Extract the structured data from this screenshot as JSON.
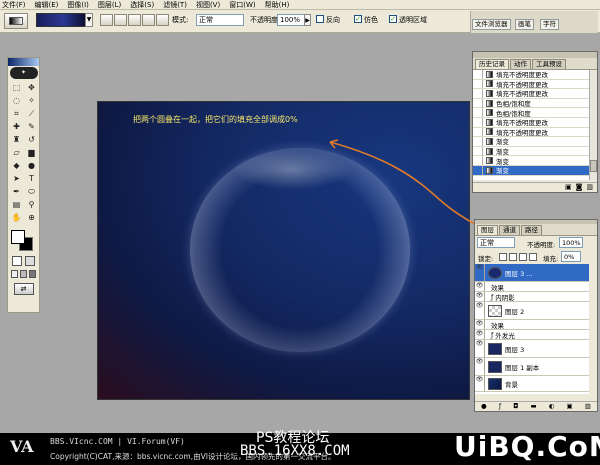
{
  "menu": [
    "文件(F)",
    "编辑(E)",
    "图像(I)",
    "图层(L)",
    "选择(S)",
    "滤镜(T)",
    "视图(V)",
    "窗口(W)",
    "帮助(H)"
  ],
  "options": {
    "mode_label": "模式:",
    "mode_value": "正常",
    "opacity_label": "不透明度:",
    "opacity_value": "100%",
    "reverse_label": "反向",
    "dither_label": "仿色",
    "transparency_label": "透明区域"
  },
  "dock_tabs": [
    "文件浏览器",
    "画笔",
    "字符"
  ],
  "canvas": {
    "caption": "把两个圆叠在一起，把它们的填充全部调成0%"
  },
  "history": {
    "tabs": [
      "历史记录",
      "动作",
      "工具预设"
    ],
    "items": [
      "填充不透明度更改",
      "填充不透明度更改",
      "填充不透明度更改",
      "色相/饱和度",
      "色相/饱和度",
      "填充不透明度更改",
      "填充不透明度更改",
      "渐变",
      "渐变",
      "渐变",
      "渐变"
    ]
  },
  "layers": {
    "tabs": [
      "图层",
      "通道",
      "路径"
    ],
    "blend_mode": "正常",
    "opacity_label": "不透明度:",
    "opacity_value": "100%",
    "lock_label": "锁定:",
    "fill_label": "填充:",
    "fill_value": "0%",
    "rows": [
      {
        "name": "图层 3 ...",
        "type": "layer",
        "selected": true
      },
      {
        "name": "效果",
        "type": "fx"
      },
      {
        "name": "内阴影",
        "type": "effect"
      },
      {
        "name": "图层 2",
        "type": "layer"
      },
      {
        "name": "效果",
        "type": "fx"
      },
      {
        "name": "外发光",
        "type": "effect"
      },
      {
        "name": "图层 3",
        "type": "layer"
      },
      {
        "name": "图层 1 副本",
        "type": "layer"
      },
      {
        "name": "背景",
        "type": "layer"
      }
    ]
  },
  "footer": {
    "url_line": "BBS.VIcnc.COM | VI.Forum(VF)",
    "copyright_line": "Copyright(C)CAT,来源：bbs.vicnc.com,由VI设计论坛，国内领先的第一交流平台。",
    "forum_title": "PS教程论坛",
    "forum_url": "BBS.16XX8.COM",
    "brand": "UiBQ.CoM"
  }
}
